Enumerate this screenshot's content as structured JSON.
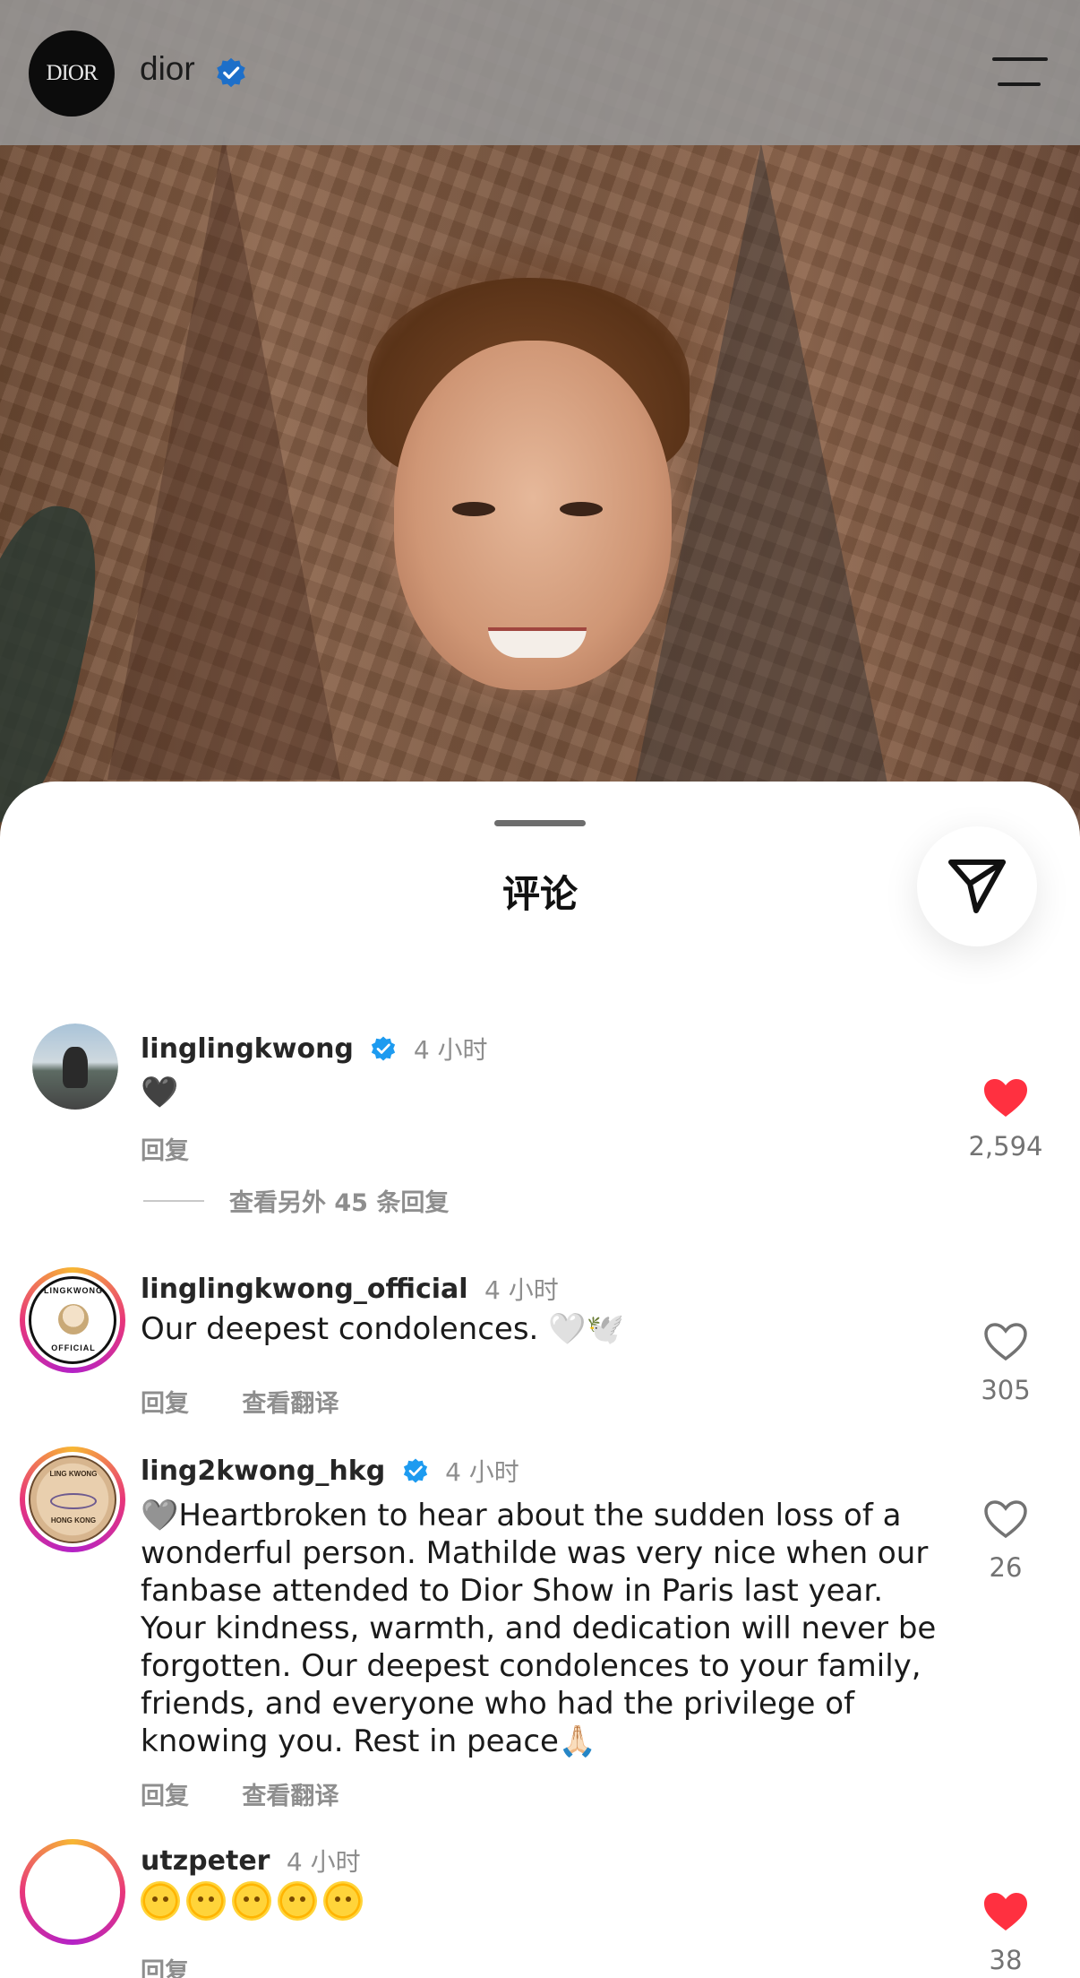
{
  "header": {
    "brand_avatar_text": "DIOR",
    "username": "dior"
  },
  "sheet": {
    "title": "评论"
  },
  "comments": [
    {
      "username": "linglingkwong",
      "verified": true,
      "time": "4 小时",
      "text": "🖤",
      "actions": [
        "回复"
      ],
      "likes": "2,594",
      "liked": true,
      "view_replies": "查看另外 45 条回复"
    },
    {
      "username": "linglingkwong_official",
      "verified": false,
      "time": "4 小时",
      "text": "Our deepest condolences. 🤍🕊️",
      "actions": [
        "回复",
        "查看翻译"
      ],
      "likes": "305",
      "liked": false,
      "avatar_text": "LingKwong Official"
    },
    {
      "username": "ling2kwong_hkg",
      "verified": true,
      "time": "4 小时",
      "text": "🩶Heartbroken to hear about the sudden loss of a wonderful person. Mathilde was very nice when our fanbase attended to Dior Show in Paris last year. Your kindness, warmth, and dedication will never be forgotten. Our deepest condolences to your family, friends, and everyone who had the privilege of knowing you. Rest in peace🙏🏻",
      "actions": [
        "回复",
        "查看翻译"
      ],
      "likes": "26",
      "liked": false,
      "avatar_text_top": "LING KWONG_HKG",
      "avatar_text_bottom": "HONG KONG"
    },
    {
      "username": "utzpeter",
      "verified": false,
      "time": "4 小时",
      "text": "🌞🌞🌞🌞🌞",
      "actions": [
        "回复"
      ],
      "likes": "38",
      "liked": true
    }
  ],
  "colors": {
    "like_red": "#ff3040",
    "verified_blue": "#1d9bf0",
    "secondary_text": "#8e8e8e"
  }
}
